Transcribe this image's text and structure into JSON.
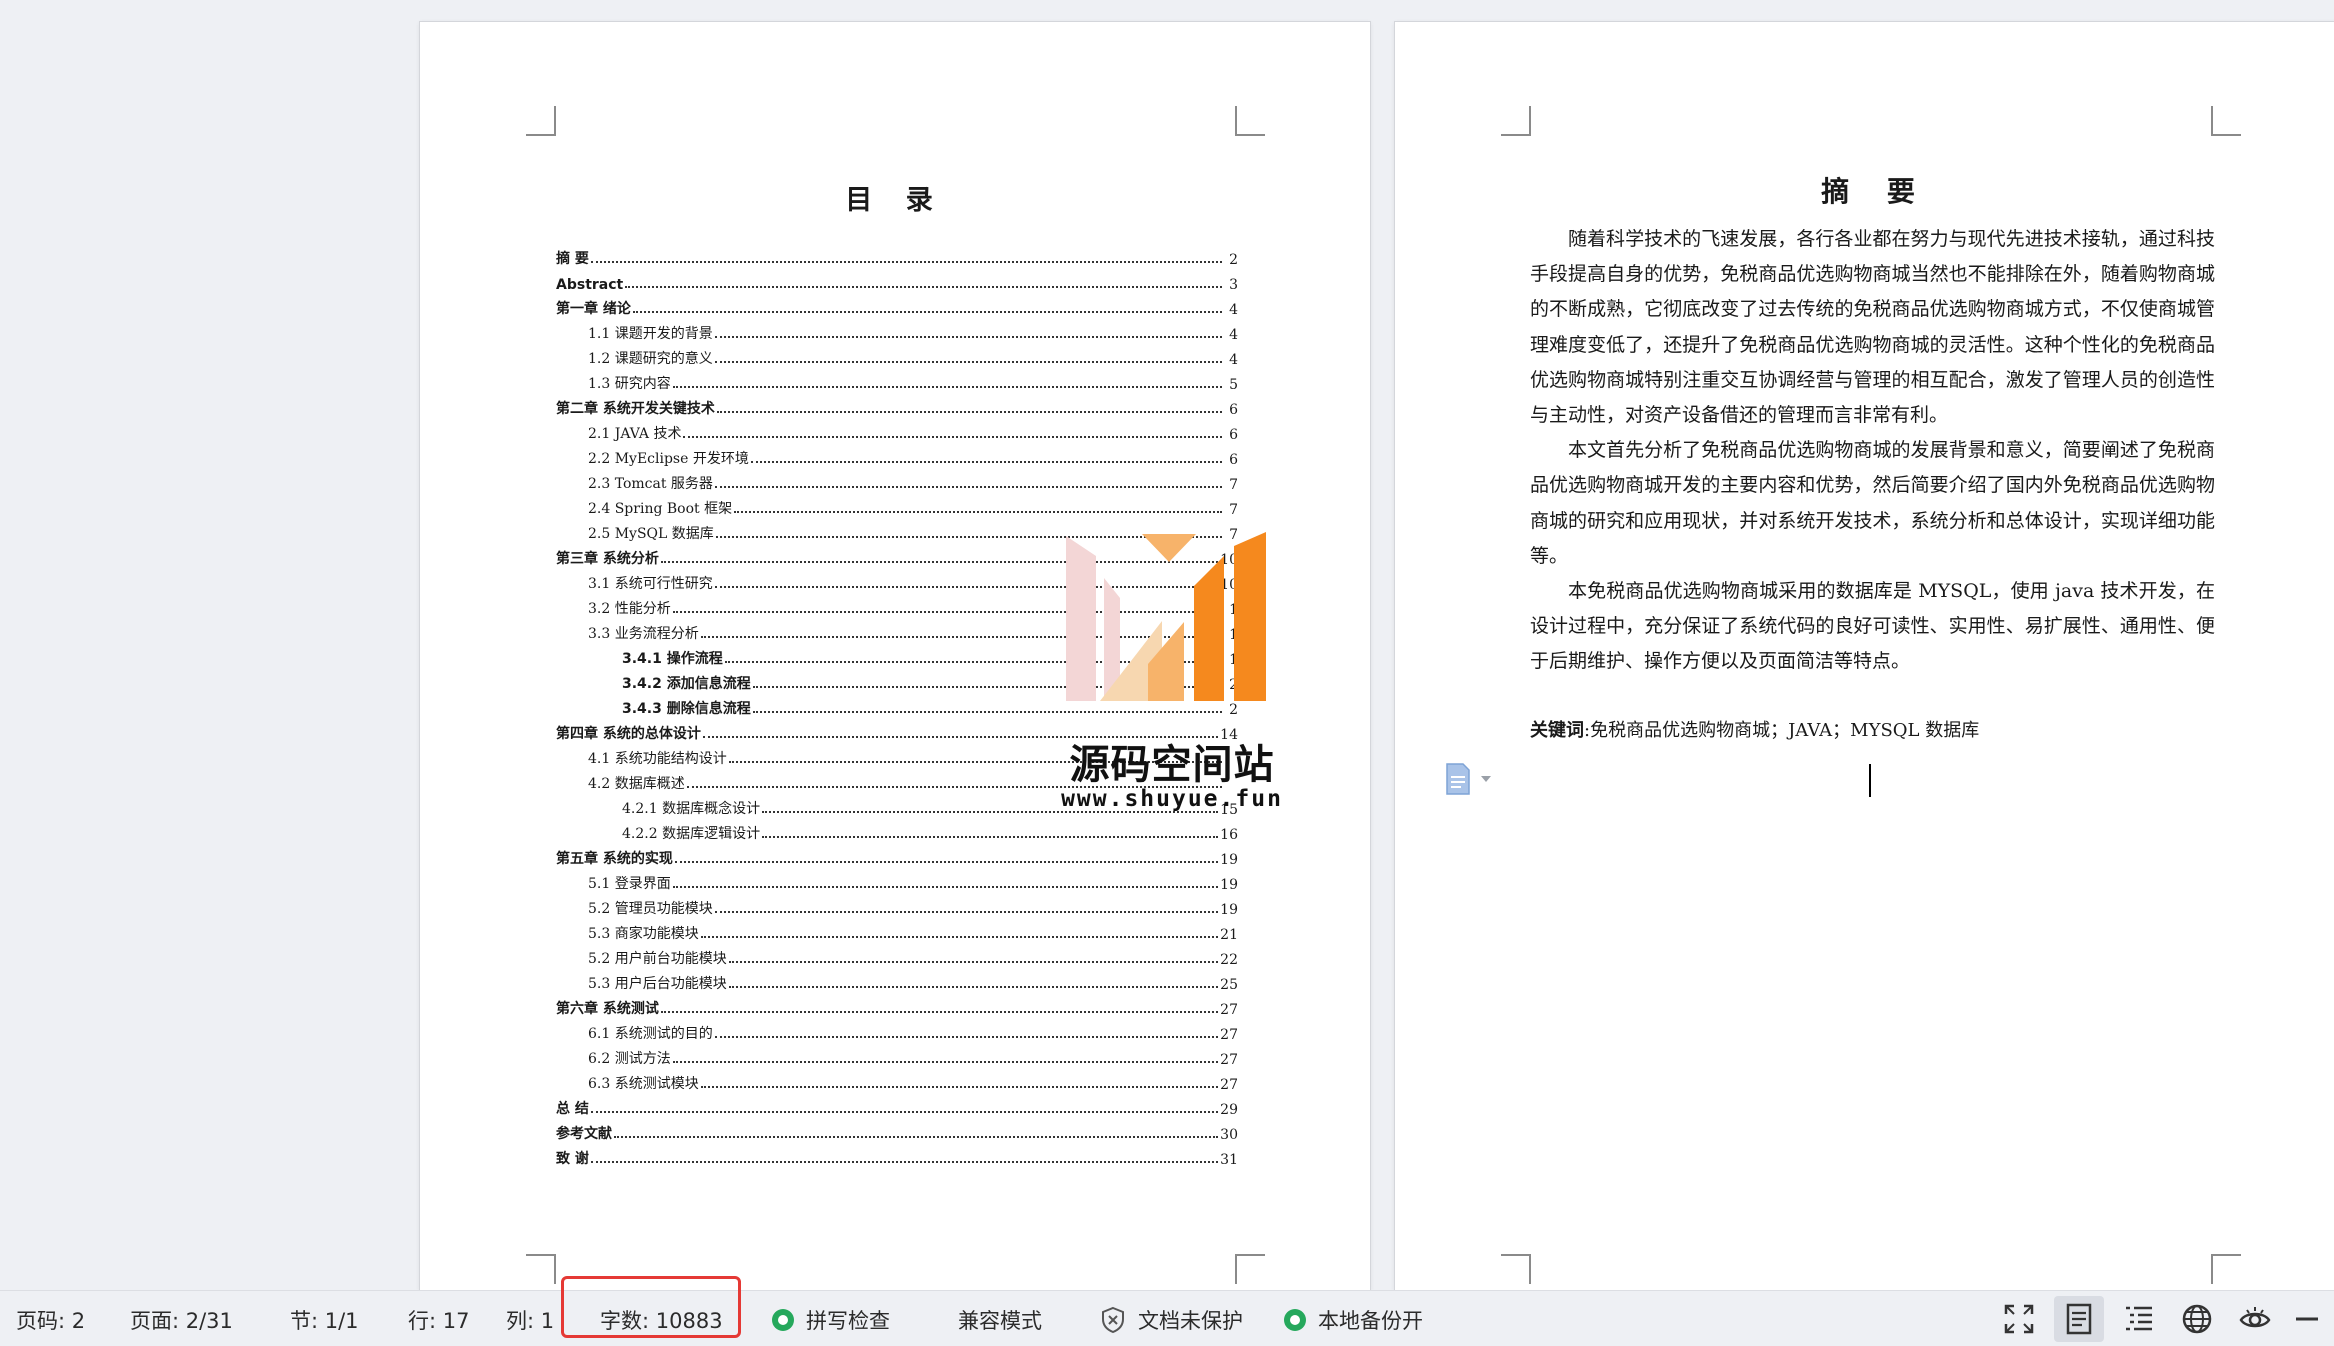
{
  "toc": {
    "title": "目 录",
    "entries": [
      {
        "level": 1,
        "text": "摘  要",
        "page": "2"
      },
      {
        "level": 1,
        "text": "Abstract",
        "page": "3"
      },
      {
        "level": 1,
        "text": "第一章  绪论",
        "page": "4"
      },
      {
        "level": 2,
        "text": "1.1 课题开发的背景",
        "page": "4"
      },
      {
        "level": 2,
        "text": "1.2 课题研究的意义",
        "page": "4"
      },
      {
        "level": 2,
        "text": "1.3 研究内容",
        "page": "5"
      },
      {
        "level": 1,
        "text": "第二章  系统开发关键技术",
        "page": "6"
      },
      {
        "level": 2,
        "text": "2.1 JAVA 技术",
        "page": "6"
      },
      {
        "level": 2,
        "text": "2.2 MyEclipse 开发环境",
        "page": "6"
      },
      {
        "level": 2,
        "text": "2.3 Tomcat 服务器",
        "page": "7"
      },
      {
        "level": 2,
        "text": "2.4 Spring  Boot 框架",
        "page": "7"
      },
      {
        "level": 2,
        "text": "2.5 MySQL 数据库",
        "page": "7"
      },
      {
        "level": 1,
        "text": "第三章  系统分析",
        "page": "10"
      },
      {
        "level": 2,
        "text": "3.1 系统可行性研究",
        "page": "10"
      },
      {
        "level": 2,
        "text": "3.2 性能分析",
        "page": "1"
      },
      {
        "level": 2,
        "text": "3.3 业务流程分析",
        "page": "1"
      },
      {
        "level": 4,
        "text": "3.4.1 操作流程",
        "page": "1"
      },
      {
        "level": 4,
        "text": "3.4.2 添加信息流程",
        "page": "2"
      },
      {
        "level": 4,
        "text": "3.4.3 删除信息流程",
        "page": "2"
      },
      {
        "level": 1,
        "text": "第四章  系统的总体设计",
        "page": "14"
      },
      {
        "level": 2,
        "text": "4.1 系统功能结构设计",
        "page": ""
      },
      {
        "level": 2,
        "text": "4.2 数据库概述",
        "page": ""
      },
      {
        "level": 3,
        "text": "4.2.1 数据库概念设计",
        "page": "15"
      },
      {
        "level": 3,
        "text": "4.2.2 数据库逻辑设计",
        "page": "16"
      },
      {
        "level": 1,
        "text": "第五章  系统的实现",
        "page": "19"
      },
      {
        "level": 2,
        "text": "5.1 登录界面",
        "page": "19"
      },
      {
        "level": 2,
        "text": "5.2 管理员功能模块",
        "page": "19"
      },
      {
        "level": 2,
        "text": "5.3 商家功能模块",
        "page": "21"
      },
      {
        "level": 2,
        "text": "5.2 用户前台功能模块",
        "page": "22"
      },
      {
        "level": 2,
        "text": "5.3 用户后台功能模块",
        "page": "25"
      },
      {
        "level": 1,
        "text": "第六章  系统测试",
        "page": "27"
      },
      {
        "level": 2,
        "text": "6.1 系统测试的目的",
        "page": "27"
      },
      {
        "level": 2,
        "text": "6.2 测试方法",
        "page": "27"
      },
      {
        "level": 2,
        "text": "6.3 系统测试模块",
        "page": "27"
      },
      {
        "level": 1,
        "text": "总  结",
        "page": "29"
      },
      {
        "level": 1,
        "text": "参考文献",
        "page": "30"
      },
      {
        "level": 1,
        "text": "致  谢",
        "page": "31"
      }
    ]
  },
  "watermark": {
    "name": "源码空间站",
    "url": "www.shuyue.fun",
    "colors": {
      "orange": "#f5891e",
      "light_orange": "#f7b36a",
      "pink": "#f3d6d6"
    }
  },
  "abstract": {
    "title": "摘 要",
    "paragraphs": [
      "随着科学技术的飞速发展，各行各业都在努力与现代先进技术接轨，通过科技手段提高自身的优势，免税商品优选购物商城当然也不能排除在外，随着购物商城的不断成熟，它彻底改变了过去传统的免税商品优选购物商城方式，不仅使商城管理难度变低了，还提升了免税商品优选购物商城的灵活性。这种个性化的免税商品优选购物商城特别注重交互协调经营与管理的相互配合，激发了管理人员的创造性与主动性，对资产设备借还的管理而言非常有利。",
      "本文首先分析了免税商品优选购物商城的发展背景和意义，简要阐述了免税商品优选购物商城开发的主要内容和优势，然后简要介绍了国内外免税商品优选购物商城的研究和应用现状，并对系统开发技术，系统分析和总体设计，实现详细功能等。",
      "本免税商品优选购物商城采用的数据库是 MYSQL，使用 java 技术开发，在设计过程中，充分保证了系统代码的良好可读性、实用性、易扩展性、通用性、便于后期维护、操作方便以及页面简洁等特点。"
    ],
    "keywords_label": "关键词",
    "keywords_value": ":免税商品优选购物商城；JAVA；MYSQL 数据库"
  },
  "statusbar": {
    "page_code": "页码: 2",
    "pages": "页面: 2/31",
    "section": "节: 1/1",
    "row": "行: 17",
    "col": "列: 1",
    "word_count": "字数: 10883",
    "spell_check": "拼写检查",
    "compat_mode": "兼容模式",
    "doc_protect": "文档未保护",
    "local_backup": "本地备份开",
    "accent": "#25a85c",
    "highlight": "#e53935"
  }
}
